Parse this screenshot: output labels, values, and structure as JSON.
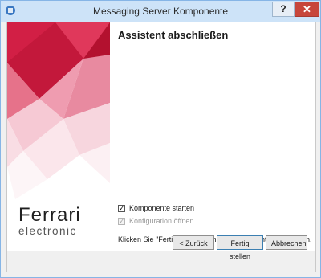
{
  "window": {
    "title": "Messaging Server Komponente",
    "help_label": "?",
    "close_label": "✕"
  },
  "brand": {
    "logo_main": "Ferrari",
    "logo_sub": "electronic"
  },
  "main": {
    "heading": "Assistent abschließen",
    "checkboxes": [
      {
        "label": "Komponente starten",
        "checked": true,
        "enabled": true
      },
      {
        "label": "Konfiguration öffnen",
        "checked": true,
        "enabled": false
      }
    ],
    "info_text": "Klicken Sie \"Fertig stellen\", um die Komponente zu erstellen."
  },
  "buttons": {
    "back": "< Zurück",
    "finish": "Fertig stellen",
    "cancel": "Abbrechen"
  },
  "colors": {
    "accent_red": "#c4163a",
    "titlebar": "#cde3f8"
  }
}
